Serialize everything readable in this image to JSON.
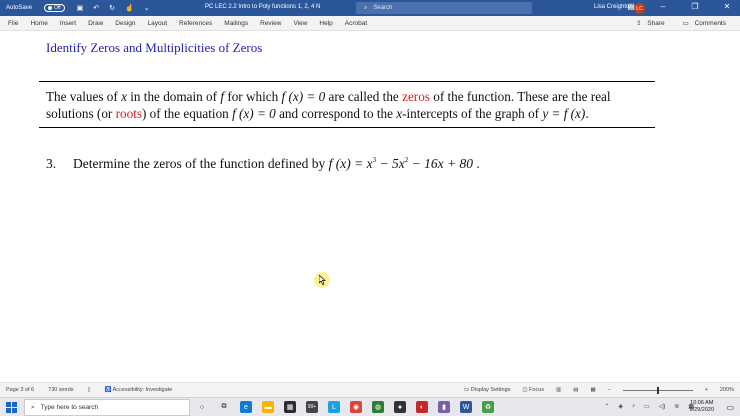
{
  "titlebar": {
    "autosave_label": "AutoSave",
    "autosave_state": "Off",
    "document_title": "PC LEC 2.2 Intro to Poly functions 1, 2, 4 N",
    "search_placeholder": "Search",
    "user_name": "Lisa Creighton",
    "user_initials": "LC"
  },
  "ribbon": {
    "tabs": [
      "File",
      "Home",
      "Insert",
      "Draw",
      "Design",
      "Layout",
      "References",
      "Mailings",
      "Review",
      "View",
      "Help",
      "Acrobat"
    ],
    "share_label": "Share",
    "comments_label": "Comments"
  },
  "document": {
    "heading": "Identify Zeros and Multiplicities of Zeros",
    "definition": {
      "t1": "The values of ",
      "t2": "x",
      "t3": " in the domain of ",
      "t4": "f",
      "t5": " for which ",
      "t6": "f (x) = 0",
      "t7": " are called the ",
      "zeros": "zeros",
      "t8": " of the function. These are the real solutions (or ",
      "roots": "roots",
      "t9": ") of the equation ",
      "t10": "f (x) = 0",
      "t11": " and correspond to the ",
      "t12": "x",
      "t13": "-intercepts of the graph of ",
      "t14": "y = f (x)",
      "t15": "."
    },
    "question": {
      "number": "3.",
      "text": "Determine the zeros of the function defined by ",
      "f_lhs": "f (x) = x",
      "exp1": "3",
      "mid": " − 5x",
      "exp2": "2",
      "rest": " − 16x + 80",
      "end": " ."
    }
  },
  "statusbar": {
    "page": "Page 3 of 6",
    "words": "730 words",
    "accessibility": "Accessibility: Investigate",
    "display_settings": "Display Settings",
    "focus": "Focus",
    "zoom": "200%"
  },
  "taskbar": {
    "search_placeholder": "Type here to search",
    "badge": "99+",
    "time": "10:06 AM",
    "date": "9/29/2020"
  },
  "colors": {
    "title_bar": "#2b579a",
    "heading": "#1f1fb8",
    "highlight_red": "#e01b1b"
  }
}
